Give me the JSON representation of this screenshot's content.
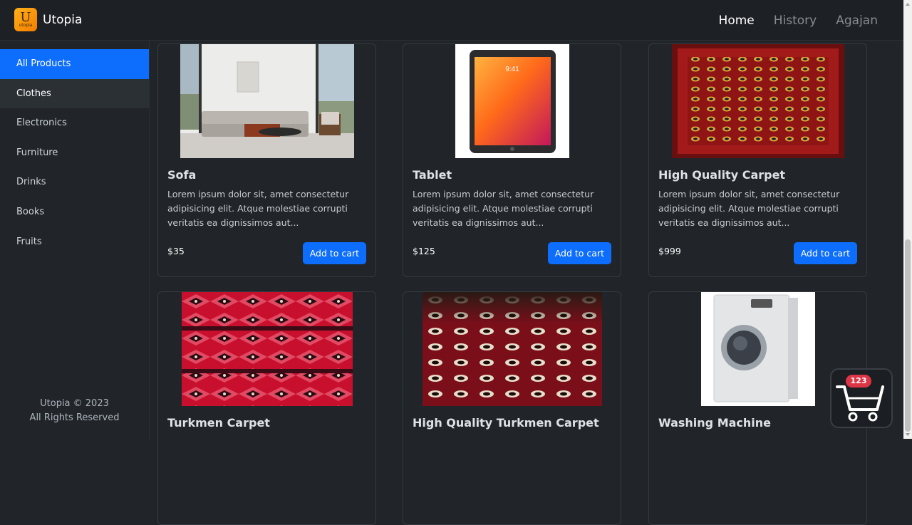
{
  "navbar": {
    "logo_letter": "U",
    "logo_sub": "utopia",
    "brand": "Utopia",
    "links": [
      "Home",
      "History",
      "Agajan"
    ]
  },
  "sidebar": {
    "items": [
      "All Products",
      "Clothes",
      "Electronics",
      "Furniture",
      "Drinks",
      "Books",
      "Fruits"
    ],
    "footer_line1": "Utopia © 2023",
    "footer_line2": "All Rights Reserved"
  },
  "products": [
    {
      "title": "Sofa",
      "description": "Lorem ipsum dolor sit, amet consectetur adipisicing elit. Atque molestiae corrupti veritatis ea dignissimos aut...",
      "price": "$35",
      "button": "Add to cart"
    },
    {
      "title": "Tablet",
      "description": "Lorem ipsum dolor sit, amet consectetur adipisicing elit. Atque molestiae corrupti veritatis ea dignissimos aut...",
      "price": "$125",
      "button": "Add to cart",
      "screen_time": "9:41"
    },
    {
      "title": "High Quality Carpet",
      "description": "Lorem ipsum dolor sit, amet consectetur adipisicing elit. Atque molestiae corrupti veritatis ea dignissimos aut...",
      "price": "$999",
      "button": "Add to cart"
    },
    {
      "title": "Turkmen Carpet"
    },
    {
      "title": "High Quality Turkmen Carpet"
    },
    {
      "title": "Washing Machine"
    }
  ],
  "cart": {
    "count": "123"
  },
  "colors": {
    "accent": "#0d6efd",
    "badge": "#dc3545",
    "background": "#212529"
  }
}
